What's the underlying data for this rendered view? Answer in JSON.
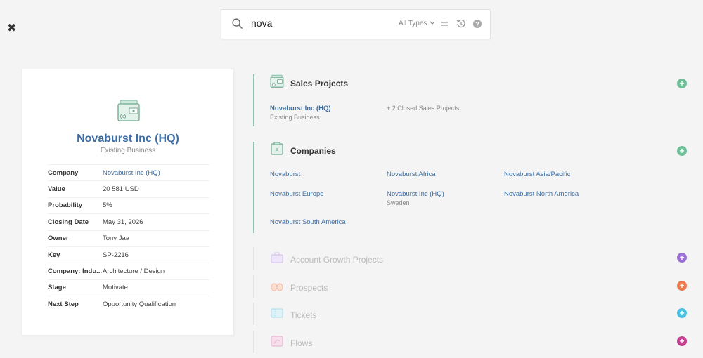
{
  "close_label": "✖",
  "search": {
    "query": "nova",
    "placeholder": "",
    "types_label": "All Types"
  },
  "record": {
    "title": "Novaburst Inc (HQ)",
    "subtitle": "Existing Business",
    "fields": [
      {
        "key": "Company",
        "value": "Novaburst Inc (HQ)",
        "link": true
      },
      {
        "key": "Value",
        "value": "20 581 USD"
      },
      {
        "key": "Probability",
        "value": "5%"
      },
      {
        "key": "Closing Date",
        "value": "May 31, 2026"
      },
      {
        "key": "Owner",
        "value": "Tony Jaa"
      },
      {
        "key": "Key",
        "value": "SP-2216"
      },
      {
        "key": "Company: Indu...",
        "value": "Architecture / Design"
      },
      {
        "key": "Stage",
        "value": "Motivate"
      },
      {
        "key": "Next Step",
        "value": "Opportunity Qualification"
      }
    ]
  },
  "sales_projects": {
    "title": "Sales Projects",
    "item_name": "Novaburst Inc (HQ)",
    "item_sub": "Existing Business",
    "more": "+ 2 Closed Sales Projects"
  },
  "companies": {
    "title": "Companies",
    "items": [
      {
        "name": "Novaburst",
        "sub": ""
      },
      {
        "name": "Novaburst Africa",
        "sub": ""
      },
      {
        "name": "Novaburst Asia/Pacific",
        "sub": ""
      },
      {
        "name": "Novaburst Europe",
        "sub": ""
      },
      {
        "name": "Novaburst Inc (HQ)",
        "sub": "Sweden"
      },
      {
        "name": "Novaburst North America",
        "sub": ""
      },
      {
        "name": "Novaburst South America",
        "sub": ""
      }
    ]
  },
  "empty_sections": [
    {
      "title": "Account Growth Projects",
      "color": "#9b6fd6"
    },
    {
      "title": "Prospects",
      "color": "#ec7a4e"
    },
    {
      "title": "Tickets",
      "color": "#49c0e0"
    },
    {
      "title": "Flows",
      "color": "#c2408f"
    }
  ],
  "colors": {
    "accent_link": "#3c6ea5",
    "green_plus": "#6fbf98",
    "border_active": "#8fc4ad"
  }
}
